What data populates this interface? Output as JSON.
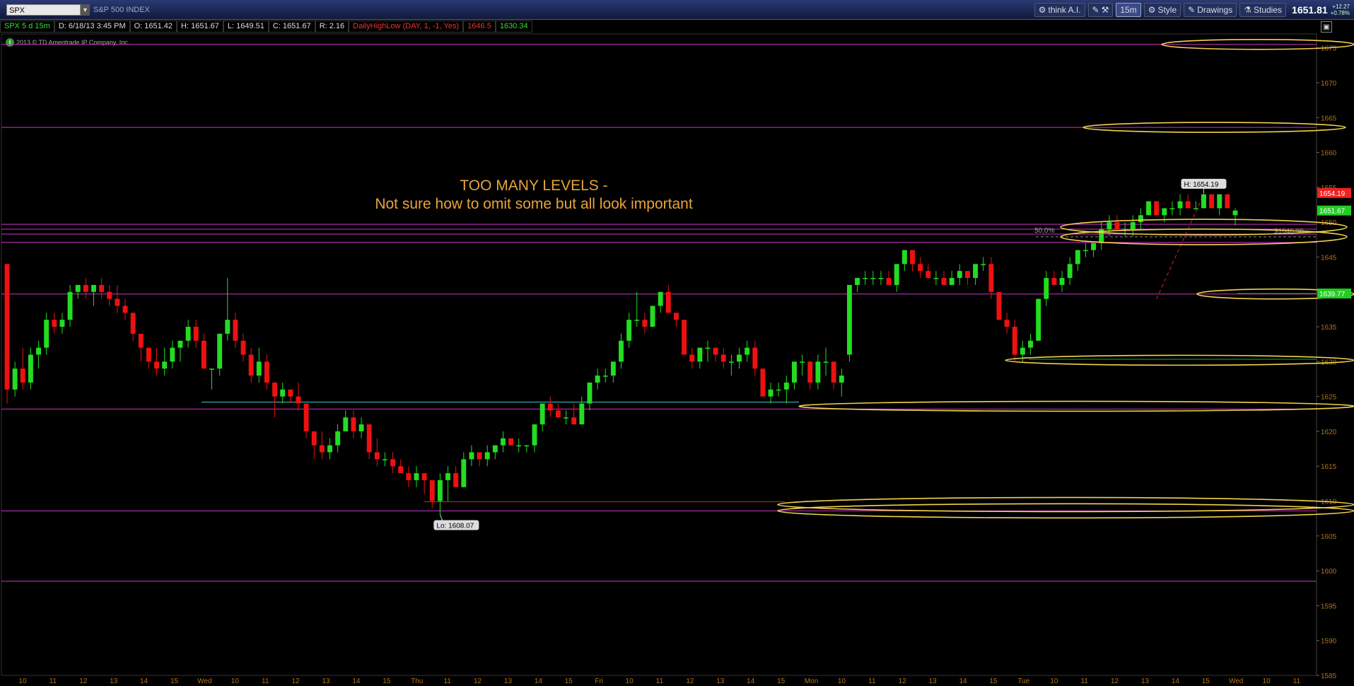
{
  "toolbar": {
    "symbol": "SPX",
    "description": "S&P 500 INDEX",
    "think_ai": "think A.I.",
    "timeframe": "15m",
    "style": "Style",
    "drawings": "Drawings",
    "studies": "Studies",
    "last_price": "1651.81",
    "change": "+12.27",
    "change_pct": "+0.78%"
  },
  "info": {
    "symbol": "SPX 5 d 15m",
    "date": "D: 6/18/13 3:45 PM",
    "open": "O: 1651.42",
    "high": "H: 1651.67",
    "low": "L: 1649.51",
    "close": "C: 1651.67",
    "range": "R: 2.16",
    "study": "DailyHighLow (DAY, 1, -1, Yes)",
    "study_v1": "1646.5",
    "study_v2": "1630.34"
  },
  "copyright": "2013 © TD Ameritrade IP Company, Inc.",
  "annotation": {
    "line1": "TOO MANY LEVELS -",
    "line2": "Not sure how to omit some but all look important"
  },
  "colors": {
    "up": "#22dd22",
    "down": "#ee1111",
    "level": "#cc33cc",
    "highlight": "#f2d24a",
    "annotation": "#e8a33c",
    "axis_text": "#b0741c"
  },
  "chart_data": {
    "type": "candlestick",
    "ylim": [
      1585,
      1677
    ],
    "y_ticks": [
      1585,
      1590,
      1595,
      1600,
      1605,
      1610,
      1615,
      1620,
      1625,
      1630,
      1635,
      1640,
      1645,
      1650,
      1655,
      1660,
      1665,
      1670,
      1675
    ],
    "x_labels": [
      "10",
      "11",
      "12",
      "13",
      "14",
      "15",
      "Wed",
      "10",
      "11",
      "12",
      "13",
      "14",
      "15",
      "Thu",
      "11",
      "12",
      "13",
      "14",
      "15",
      "Fri",
      "10",
      "11",
      "12",
      "13",
      "14",
      "15",
      "Mon",
      "10",
      "11",
      "12",
      "13",
      "14",
      "15",
      "Tue",
      "10",
      "11",
      "12",
      "13",
      "14",
      "15",
      "Wed",
      "10",
      "11"
    ],
    "candles": [
      [
        1644,
        1644,
        1624,
        1626
      ],
      [
        1626,
        1630,
        1625,
        1629
      ],
      [
        1629,
        1632,
        1626,
        1627
      ],
      [
        1627,
        1632,
        1626,
        1631
      ],
      [
        1631,
        1633,
        1629,
        1632
      ],
      [
        1632,
        1637,
        1631,
        1636
      ],
      [
        1636,
        1637,
        1634,
        1635
      ],
      [
        1635,
        1637,
        1634,
        1636
      ],
      [
        1636,
        1641,
        1635,
        1640
      ],
      [
        1640,
        1641,
        1639,
        1641
      ],
      [
        1641,
        1642,
        1639,
        1640
      ],
      [
        1640,
        1641,
        1638,
        1641
      ],
      [
        1641,
        1642,
        1639,
        1640
      ],
      [
        1640,
        1641,
        1638,
        1639
      ],
      [
        1639,
        1641,
        1637,
        1638
      ],
      [
        1638,
        1639,
        1636,
        1637
      ],
      [
        1637,
        1637,
        1633,
        1634
      ],
      [
        1634,
        1634,
        1630,
        1632
      ],
      [
        1632,
        1632,
        1629,
        1630
      ],
      [
        1630,
        1632,
        1628,
        1629
      ],
      [
        1629,
        1632,
        1628,
        1630
      ],
      [
        1630,
        1633,
        1629,
        1632
      ],
      [
        1632,
        1633,
        1630,
        1633
      ],
      [
        1633,
        1636,
        1632,
        1635
      ],
      [
        1635,
        1636,
        1632,
        1633
      ],
      [
        1633,
        1634,
        1629,
        1629
      ],
      [
        1629,
        1629,
        1626,
        1629
      ],
      [
        1629,
        1634,
        1628,
        1634
      ],
      [
        1634,
        1642,
        1633,
        1636
      ],
      [
        1636,
        1637,
        1632,
        1633
      ],
      [
        1633,
        1634,
        1630,
        1631
      ],
      [
        1631,
        1632,
        1627,
        1628
      ],
      [
        1628,
        1632,
        1627,
        1630
      ],
      [
        1630,
        1631,
        1626,
        1627
      ],
      [
        1627,
        1627,
        1622,
        1625
      ],
      [
        1625,
        1627,
        1624,
        1626
      ],
      [
        1626,
        1626,
        1624,
        1625
      ],
      [
        1625,
        1627,
        1623,
        1624
      ],
      [
        1624,
        1624,
        1619,
        1620
      ],
      [
        1620,
        1620,
        1616,
        1618
      ],
      [
        1618,
        1620,
        1616,
        1617
      ],
      [
        1617,
        1619,
        1616,
        1618
      ],
      [
        1618,
        1621,
        1617,
        1620
      ],
      [
        1620,
        1623,
        1620,
        1622
      ],
      [
        1622,
        1623,
        1619,
        1620
      ],
      [
        1620,
        1622,
        1619,
        1621
      ],
      [
        1621,
        1621,
        1616,
        1617
      ],
      [
        1617,
        1619,
        1615,
        1616
      ],
      [
        1616,
        1617,
        1615,
        1616
      ],
      [
        1616,
        1617,
        1614,
        1615
      ],
      [
        1615,
        1616,
        1614,
        1614
      ],
      [
        1614,
        1615,
        1612,
        1613
      ],
      [
        1613,
        1615,
        1612,
        1614
      ],
      [
        1614,
        1614,
        1611,
        1613
      ],
      [
        1613,
        1613,
        1609,
        1610
      ],
      [
        1610,
        1614,
        1608.07,
        1613
      ],
      [
        1613,
        1615,
        1610,
        1614
      ],
      [
        1614,
        1615,
        1612,
        1612
      ],
      [
        1612,
        1617,
        1612,
        1616
      ],
      [
        1616,
        1618,
        1615,
        1617
      ],
      [
        1617,
        1617,
        1615,
        1616
      ],
      [
        1616,
        1618,
        1615,
        1617
      ],
      [
        1617,
        1618,
        1616,
        1618
      ],
      [
        1618,
        1620,
        1617,
        1619
      ],
      [
        1619,
        1619,
        1618,
        1618
      ],
      [
        1618,
        1619,
        1617,
        1618
      ],
      [
        1618,
        1618,
        1617,
        1618
      ],
      [
        1618,
        1621,
        1617,
        1621
      ],
      [
        1621,
        1624,
        1620,
        1624
      ],
      [
        1624,
        1625,
        1622,
        1623
      ],
      [
        1623,
        1624,
        1622,
        1622
      ],
      [
        1622,
        1623,
        1621,
        1622
      ],
      [
        1622,
        1624,
        1621,
        1621
      ],
      [
        1621,
        1625,
        1621,
        1624
      ],
      [
        1624,
        1627,
        1623,
        1627
      ],
      [
        1627,
        1629,
        1626,
        1628
      ],
      [
        1628,
        1629,
        1627,
        1628
      ],
      [
        1628,
        1630,
        1627,
        1630
      ],
      [
        1630,
        1634,
        1629,
        1633
      ],
      [
        1633,
        1637,
        1632,
        1636
      ],
      [
        1636,
        1640,
        1635,
        1636
      ],
      [
        1636,
        1637,
        1634,
        1635
      ],
      [
        1635,
        1638,
        1635,
        1638
      ],
      [
        1638,
        1640,
        1637,
        1640
      ],
      [
        1640,
        1641,
        1637,
        1637
      ],
      [
        1637,
        1637,
        1635,
        1636
      ],
      [
        1636,
        1636,
        1631,
        1631
      ],
      [
        1631,
        1632,
        1629,
        1630
      ],
      [
        1630,
        1632,
        1629,
        1632
      ],
      [
        1632,
        1633,
        1630,
        1632
      ],
      [
        1632,
        1632,
        1630,
        1631
      ],
      [
        1631,
        1632,
        1629,
        1630
      ],
      [
        1630,
        1631,
        1628,
        1630
      ],
      [
        1630,
        1632,
        1629,
        1631
      ],
      [
        1631,
        1633,
        1630,
        1632
      ],
      [
        1632,
        1633,
        1628,
        1629
      ],
      [
        1629,
        1629,
        1625,
        1625
      ],
      [
        1625,
        1627,
        1624,
        1626
      ],
      [
        1626,
        1627,
        1625,
        1626
      ],
      [
        1626,
        1628,
        1624,
        1627
      ],
      [
        1627,
        1630,
        1626,
        1630
      ],
      [
        1630,
        1631,
        1628,
        1630
      ],
      [
        1630,
        1630,
        1626,
        1627
      ],
      [
        1627,
        1631,
        1626,
        1630
      ],
      [
        1630,
        1632,
        1628,
        1630
      ],
      [
        1630,
        1630,
        1626,
        1627
      ],
      [
        1627,
        1629,
        1625,
        1628
      ],
      [
        1631,
        1641,
        1630,
        1641
      ],
      [
        1641,
        1642,
        1640,
        1642
      ],
      [
        1642,
        1643,
        1641,
        1642
      ],
      [
        1642,
        1643,
        1641,
        1642
      ],
      [
        1642,
        1643,
        1641,
        1642
      ],
      [
        1642,
        1643,
        1641,
        1641
      ],
      [
        1641,
        1644,
        1640,
        1644
      ],
      [
        1644,
        1646,
        1643,
        1646
      ],
      [
        1646,
        1646,
        1643,
        1644
      ],
      [
        1644,
        1645,
        1642,
        1643
      ],
      [
        1643,
        1644,
        1642,
        1642
      ],
      [
        1642,
        1643,
        1641,
        1642
      ],
      [
        1642,
        1643,
        1641,
        1641
      ],
      [
        1641,
        1643,
        1641,
        1642
      ],
      [
        1642,
        1644,
        1641,
        1643
      ],
      [
        1643,
        1643,
        1641,
        1642
      ],
      [
        1642,
        1644,
        1641,
        1644
      ],
      [
        1644,
        1645,
        1643,
        1644
      ],
      [
        1644,
        1645,
        1639,
        1640
      ],
      [
        1640,
        1640,
        1636,
        1636
      ],
      [
        1636,
        1637,
        1634,
        1635
      ],
      [
        1635,
        1636,
        1630,
        1631
      ],
      [
        1631,
        1633,
        1630,
        1632
      ],
      [
        1632,
        1634,
        1631,
        1633
      ],
      [
        1633,
        1639,
        1633,
        1639
      ],
      [
        1639,
        1643,
        1638,
        1642
      ],
      [
        1642,
        1643,
        1641,
        1641
      ],
      [
        1641,
        1643,
        1640,
        1642
      ],
      [
        1642,
        1645,
        1641,
        1644
      ],
      [
        1644,
        1646,
        1643,
        1646
      ],
      [
        1646,
        1647,
        1645,
        1646
      ],
      [
        1646,
        1647,
        1645,
        1647
      ],
      [
        1647,
        1650,
        1646,
        1649
      ],
      [
        1649,
        1651,
        1648,
        1650
      ],
      [
        1650,
        1651,
        1649,
        1649
      ],
      [
        1649,
        1650,
        1648,
        1649
      ],
      [
        1649,
        1651,
        1648,
        1650
      ],
      [
        1650,
        1652,
        1649,
        1651
      ],
      [
        1651,
        1653,
        1651,
        1653
      ],
      [
        1653,
        1653,
        1651,
        1651
      ],
      [
        1651,
        1652,
        1650,
        1652
      ],
      [
        1652,
        1653,
        1651,
        1652
      ],
      [
        1652,
        1654,
        1651,
        1653
      ],
      [
        1653,
        1654,
        1652,
        1652
      ],
      [
        1652,
        1653,
        1652,
        1652
      ],
      [
        1652,
        1654.19,
        1652,
        1654
      ],
      [
        1654,
        1654,
        1652,
        1652
      ],
      [
        1652,
        1654,
        1651,
        1654
      ],
      [
        1654,
        1654,
        1652,
        1652
      ],
      [
        1651,
        1652,
        1649.51,
        1651.67
      ]
    ],
    "levels": [
      1675.5,
      1663.6,
      1649.7,
      1649.0,
      1648.3,
      1647.1,
      1639.7,
      1623.2,
      1608.6,
      1598.5
    ],
    "cyan_level": 1624.2,
    "red_level": 1609.9,
    "green_levels": [
      1639.77,
      1630.34
    ],
    "ellipses": [
      1675.5,
      1663.6,
      1649.3,
      1647.9,
      1639.7,
      1630.2,
      1623.6,
      1609.5,
      1608.6
    ],
    "fib": {
      "label": "50.0%",
      "price": 1647.9
    },
    "price_label": "$1646.98",
    "price_flags": [
      {
        "text": "1654.19",
        "value": 1654.19,
        "color": "#ee2222"
      },
      {
        "text": "1651.67",
        "value": 1651.67,
        "color": "#22cc22"
      },
      {
        "text": "1639.77",
        "value": 1639.77,
        "color": "#22cc22"
      }
    ],
    "high_label": "H: 1654.19",
    "low_label": "Lo: 1608.07"
  }
}
